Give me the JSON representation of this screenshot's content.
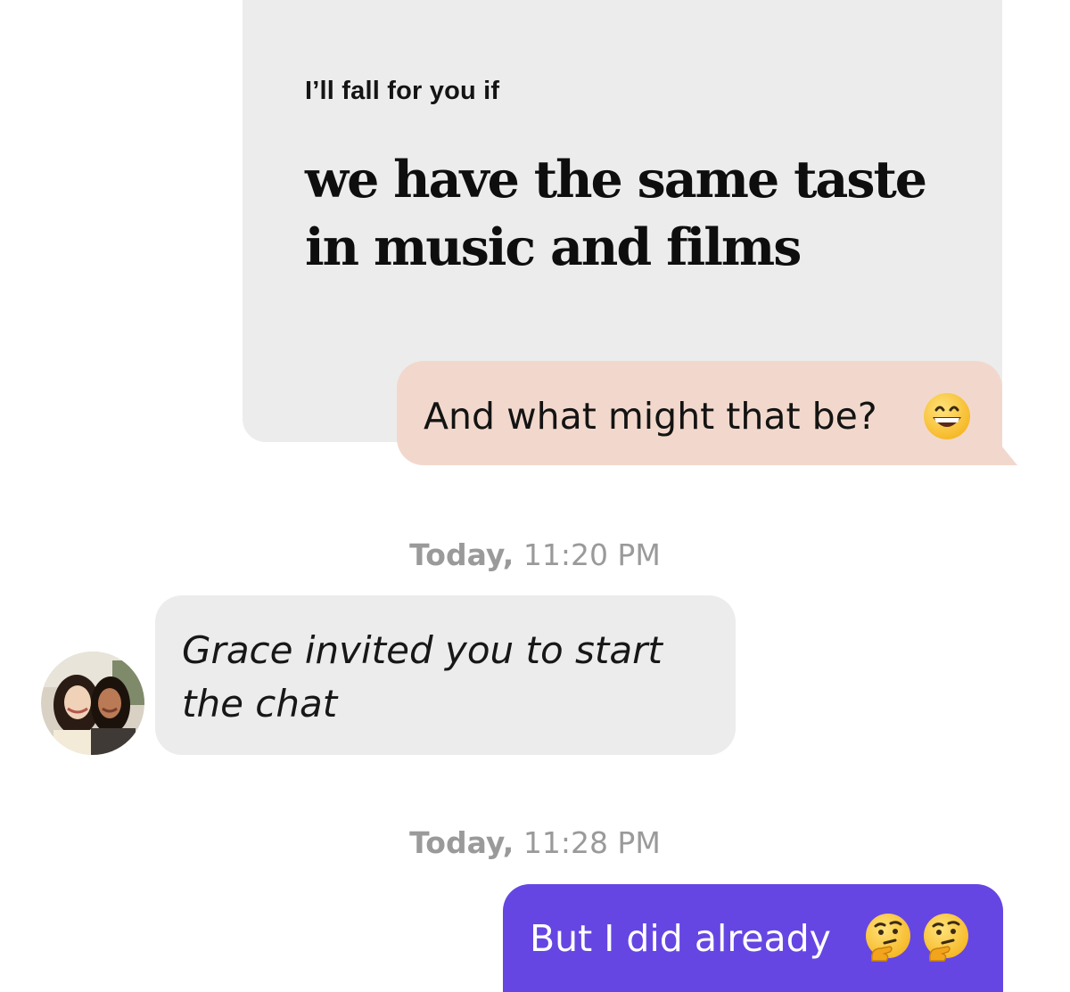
{
  "prompt": {
    "label": "I’ll fall for you if",
    "answer_line1": "we have the same taste",
    "answer_line2": "in music and films"
  },
  "reply": {
    "text": "And what might that be?",
    "emoji": "grinning-face-icon"
  },
  "timestamps": [
    {
      "day": "Today,",
      "time": "11:20 PM"
    },
    {
      "day": "Today,",
      "time": "11:28 PM"
    }
  ],
  "invite": {
    "text": "Grace invited you to start the chat"
  },
  "sent": {
    "text": "But I did already",
    "emojis": [
      "thinking-face-icon",
      "thinking-face-icon"
    ]
  },
  "colors": {
    "prompt_card": "#ececec",
    "reply_bubble": "#f2d8cc",
    "invite_bubble": "#ececec",
    "sent_bubble": "#6546e3",
    "timestamp_text": "#9a9a9a"
  }
}
